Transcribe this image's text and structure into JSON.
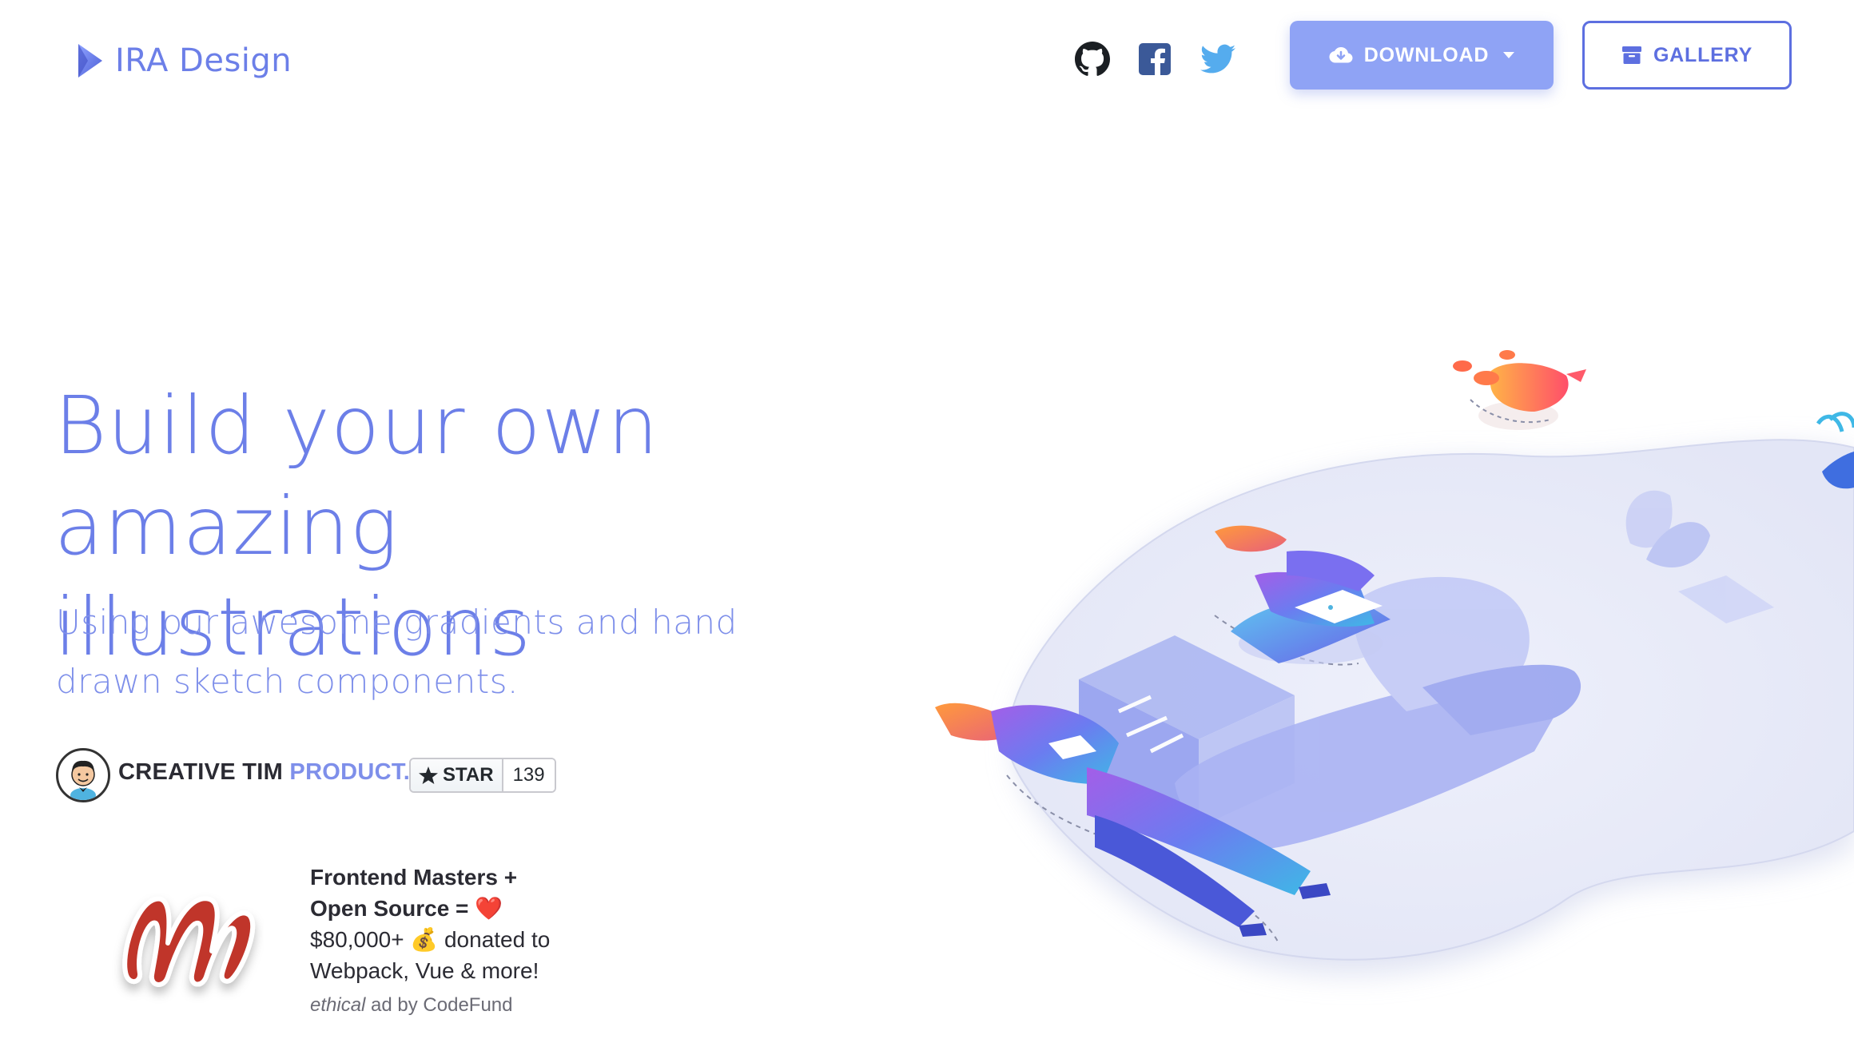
{
  "nav": {
    "brand": "IRA Design",
    "social": [
      "github-icon",
      "facebook-icon",
      "twitter-icon"
    ],
    "download_label": "DOWNLOAD",
    "gallery_label": "GALLERY"
  },
  "hero": {
    "title_line1": "Build your own",
    "title_line2": "amazing illustrations",
    "lead_line1": "Using our awesome gradients and hand",
    "lead_line2": "drawn sketch components.",
    "product_prefix": "CREATIVE TIM",
    "product_suffix": "PRODUCT.",
    "star_label": "STAR",
    "star_count": "139"
  },
  "ad": {
    "line1": "Frontend Masters +",
    "line2": "Open Source = ❤️",
    "line3": "$80,000+ 💰  donated to",
    "line4": "Webpack, Vue & more!",
    "credit_em": "ethical",
    "credit_rest": " ad by CodeFund"
  },
  "colors": {
    "brand": "#6c7fe8",
    "download_bg": "#8fa3f5",
    "gallery_border": "#5d6fe0",
    "facebook": "#3b5998",
    "twitter": "#55acee"
  }
}
